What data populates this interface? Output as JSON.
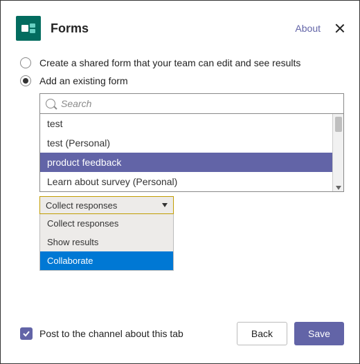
{
  "header": {
    "title": "Forms",
    "about_label": "About"
  },
  "radios": {
    "create_shared": "Create a shared form that your team can edit and see results",
    "add_existing": "Add an existing form"
  },
  "search": {
    "placeholder": "Search"
  },
  "forms_list": {
    "items": [
      {
        "label": "test"
      },
      {
        "label": "test (Personal)"
      },
      {
        "label": "product feedback"
      },
      {
        "label": "Learn about survey (Personal)"
      }
    ]
  },
  "action_dropdown": {
    "selected": "Collect responses",
    "options": [
      {
        "label": "Collect responses"
      },
      {
        "label": "Show results"
      },
      {
        "label": "Collaborate"
      }
    ]
  },
  "footer": {
    "post_label": "Post to the channel about this tab",
    "back": "Back",
    "save": "Save"
  },
  "colors": {
    "brand": "#6264a7",
    "highlight_blue": "#0078d4",
    "app_icon_bg": "#036c5f",
    "dropdown_border": "#c19c00"
  }
}
